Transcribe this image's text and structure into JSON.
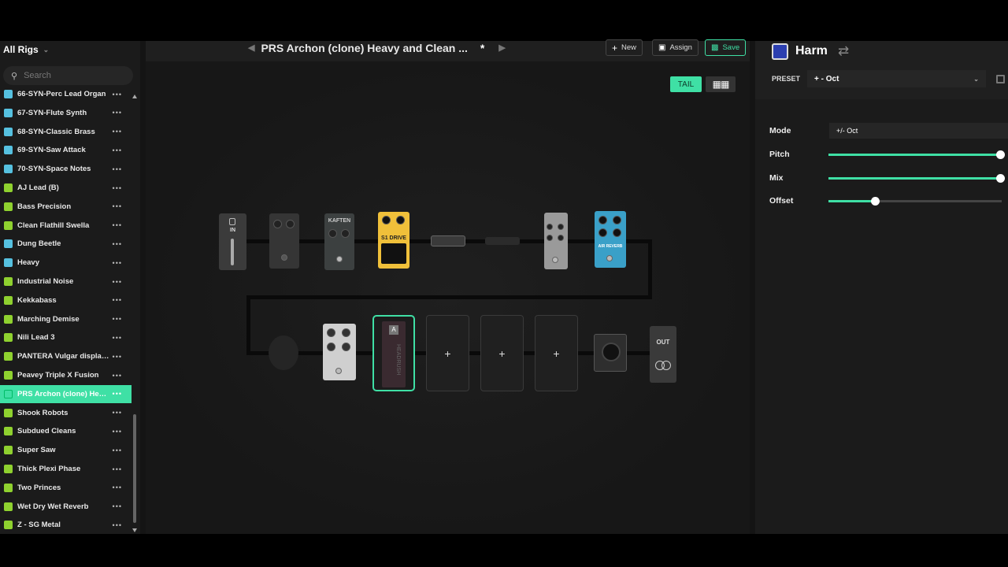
{
  "sidebar": {
    "rig_title": "All Rigs",
    "search_placeholder": "Search",
    "items": [
      {
        "label": "66-SYN-Perc Lead Organ",
        "color": "#56c1e0"
      },
      {
        "label": "67-SYN-Flute Synth",
        "color": "#56c1e0"
      },
      {
        "label": "68-SYN-Classic Brass",
        "color": "#56c1e0"
      },
      {
        "label": "69-SYN-Saw Attack",
        "color": "#56c1e0"
      },
      {
        "label": "70-SYN-Space Notes",
        "color": "#56c1e0"
      },
      {
        "label": "AJ Lead (B)",
        "color": "#8fd12f"
      },
      {
        "label": "Bass Precision",
        "color": "#8fd12f"
      },
      {
        "label": "Clean Flathill Swella",
        "color": "#8fd12f"
      },
      {
        "label": "Dung Beetle",
        "color": "#56c1e0"
      },
      {
        "label": "Heavy",
        "color": "#56c1e0"
      },
      {
        "label": "Industrial Noise",
        "color": "#8fd12f"
      },
      {
        "label": "Kekkabass",
        "color": "#8fd12f"
      },
      {
        "label": "Marching Demise",
        "color": "#8fd12f"
      },
      {
        "label": "Nili Lead 3",
        "color": "#8fd12f"
      },
      {
        "label": "PANTERA Vulgar display of ...",
        "color": "#8fd12f"
      },
      {
        "label": "Peavey Triple X Fusion",
        "color": "#8fd12f"
      },
      {
        "label": "PRS Archon (clone) Heavy ...",
        "color": "#8fd12f",
        "selected": true
      },
      {
        "label": "Shook Robots",
        "color": "#8fd12f"
      },
      {
        "label": "Subdued Cleans",
        "color": "#8fd12f"
      },
      {
        "label": "Super Saw",
        "color": "#8fd12f"
      },
      {
        "label": "Thick Plexi Phase",
        "color": "#8fd12f"
      },
      {
        "label": "Two Princes",
        "color": "#8fd12f"
      },
      {
        "label": "Wet Dry Wet Reverb",
        "color": "#8fd12f"
      },
      {
        "label": "Z - SG Metal",
        "color": "#8fd12f"
      }
    ]
  },
  "topbar": {
    "preset_title": "PRS Archon (clone) Heavy and Clean ...",
    "dirty_marker": "*",
    "new_label": "New",
    "assign_label": "Assign",
    "save_label": "Save"
  },
  "canvas": {
    "tail_label": "TAIL",
    "in_label": "IN",
    "out_label": "OUT",
    "block_texts": {
      "kaiften": "KAFTEN",
      "s1drive": "S1 DRIVE",
      "airblue": "AIR REVERB",
      "headrush": "HEADRUSH",
      "slot_a": "A"
    },
    "add_symbol": "+"
  },
  "panel": {
    "title": "Harm",
    "preset_label": "PRESET",
    "preset_value": "+ - Oct",
    "params": [
      {
        "name": "Mode",
        "value": "+/- Oct"
      },
      {
        "name": "Pitch",
        "level": 0.99
      },
      {
        "name": "Mix",
        "level": 0.99
      },
      {
        "name": "Offset",
        "level": 0.27
      }
    ],
    "accent": "#3fe0a5",
    "chip_color": "#2c3fb0"
  }
}
